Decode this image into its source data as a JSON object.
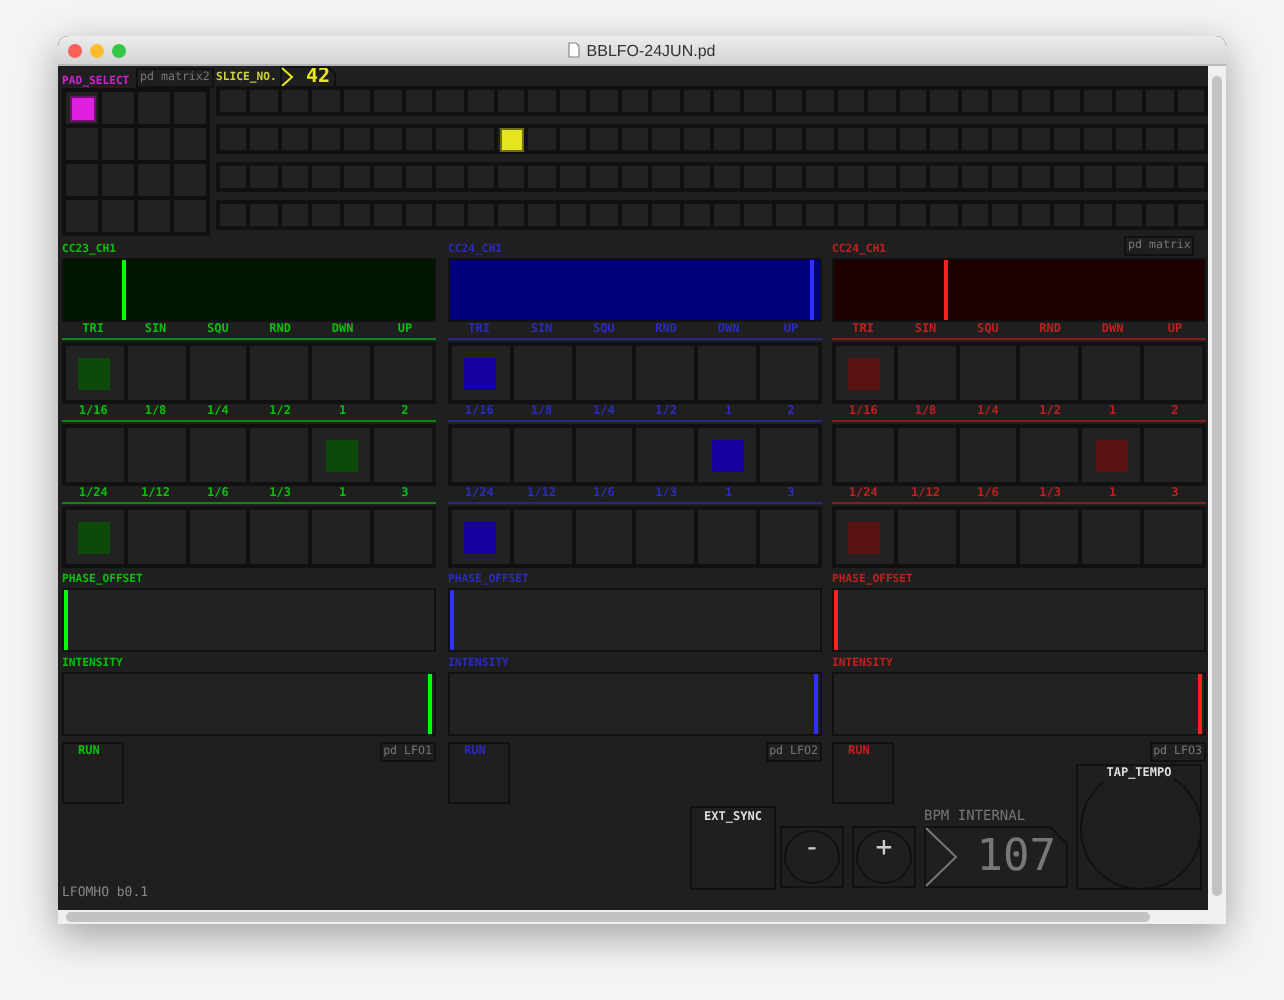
{
  "window": {
    "title": "BBLFO-24JUN.pd"
  },
  "pad_select": {
    "label": "PAD_SELECT",
    "pads": [
      {
        "selected": true
      },
      {
        "selected": false
      },
      {
        "selected": false
      },
      {
        "selected": false
      },
      {
        "selected": false
      },
      {
        "selected": false
      },
      {
        "selected": false
      },
      {
        "selected": false
      },
      {
        "selected": false
      },
      {
        "selected": false
      },
      {
        "selected": false
      },
      {
        "selected": false
      },
      {
        "selected": false
      },
      {
        "selected": false
      },
      {
        "selected": false
      },
      {
        "selected": false
      }
    ]
  },
  "matrix2_subpatch": "pd matrix2",
  "slice": {
    "label": "SLICE_NO.",
    "value": "42",
    "rows": [
      {
        "cells": [
          {
            "selected": false
          },
          {
            "selected": false
          },
          {
            "selected": false
          },
          {
            "selected": false
          },
          {
            "selected": false
          },
          {
            "selected": false
          },
          {
            "selected": false
          },
          {
            "selected": false
          },
          {
            "selected": false
          },
          {
            "selected": false
          },
          {
            "selected": false
          },
          {
            "selected": false
          },
          {
            "selected": false
          },
          {
            "selected": false
          },
          {
            "selected": false
          },
          {
            "selected": false
          },
          {
            "selected": false
          },
          {
            "selected": false
          },
          {
            "selected": false
          },
          {
            "selected": false
          },
          {
            "selected": false
          },
          {
            "selected": false
          },
          {
            "selected": false
          },
          {
            "selected": false
          },
          {
            "selected": false
          },
          {
            "selected": false
          },
          {
            "selected": false
          },
          {
            "selected": false
          },
          {
            "selected": false
          },
          {
            "selected": false
          },
          {
            "selected": false
          },
          {
            "selected": false
          }
        ]
      },
      {
        "cells": [
          {
            "selected": false
          },
          {
            "selected": false
          },
          {
            "selected": false
          },
          {
            "selected": false
          },
          {
            "selected": false
          },
          {
            "selected": false
          },
          {
            "selected": false
          },
          {
            "selected": false
          },
          {
            "selected": false
          },
          {
            "selected": true
          },
          {
            "selected": false
          },
          {
            "selected": false
          },
          {
            "selected": false
          },
          {
            "selected": false
          },
          {
            "selected": false
          },
          {
            "selected": false
          },
          {
            "selected": false
          },
          {
            "selected": false
          },
          {
            "selected": false
          },
          {
            "selected": false
          },
          {
            "selected": false
          },
          {
            "selected": false
          },
          {
            "selected": false
          },
          {
            "selected": false
          },
          {
            "selected": false
          },
          {
            "selected": false
          },
          {
            "selected": false
          },
          {
            "selected": false
          },
          {
            "selected": false
          },
          {
            "selected": false
          },
          {
            "selected": false
          },
          {
            "selected": false
          }
        ]
      },
      {
        "cells": [
          {
            "selected": false
          },
          {
            "selected": false
          },
          {
            "selected": false
          },
          {
            "selected": false
          },
          {
            "selected": false
          },
          {
            "selected": false
          },
          {
            "selected": false
          },
          {
            "selected": false
          },
          {
            "selected": false
          },
          {
            "selected": false
          },
          {
            "selected": false
          },
          {
            "selected": false
          },
          {
            "selected": false
          },
          {
            "selected": false
          },
          {
            "selected": false
          },
          {
            "selected": false
          },
          {
            "selected": false
          },
          {
            "selected": false
          },
          {
            "selected": false
          },
          {
            "selected": false
          },
          {
            "selected": false
          },
          {
            "selected": false
          },
          {
            "selected": false
          },
          {
            "selected": false
          },
          {
            "selected": false
          },
          {
            "selected": false
          },
          {
            "selected": false
          },
          {
            "selected": false
          },
          {
            "selected": false
          },
          {
            "selected": false
          },
          {
            "selected": false
          },
          {
            "selected": false
          }
        ]
      },
      {
        "cells": [
          {
            "selected": false
          },
          {
            "selected": false
          },
          {
            "selected": false
          },
          {
            "selected": false
          },
          {
            "selected": false
          },
          {
            "selected": false
          },
          {
            "selected": false
          },
          {
            "selected": false
          },
          {
            "selected": false
          },
          {
            "selected": false
          },
          {
            "selected": false
          },
          {
            "selected": false
          },
          {
            "selected": false
          },
          {
            "selected": false
          },
          {
            "selected": false
          },
          {
            "selected": false
          },
          {
            "selected": false
          },
          {
            "selected": false
          },
          {
            "selected": false
          },
          {
            "selected": false
          },
          {
            "selected": false
          },
          {
            "selected": false
          },
          {
            "selected": false
          },
          {
            "selected": false
          },
          {
            "selected": false
          },
          {
            "selected": false
          },
          {
            "selected": false
          },
          {
            "selected": false
          },
          {
            "selected": false
          },
          {
            "selected": false
          },
          {
            "selected": false
          },
          {
            "selected": false
          }
        ]
      }
    ]
  },
  "matrix_subpatch": "pd matrix",
  "lfos": [
    {
      "color": "#00ff00",
      "selection": {
        "color": "#0c4a0c"
      },
      "cc": {
        "label": "CC23_CH1",
        "level": 0.16,
        "color": "#001800"
      },
      "radios": [
        {
          "options": [
            {
              "label": "TRI",
              "selected": true
            },
            {
              "label": "SIN",
              "selected": false
            },
            {
              "label": "SQU",
              "selected": false
            },
            {
              "label": "RND",
              "selected": false
            },
            {
              "label": "DWN",
              "selected": false
            },
            {
              "label": "UP",
              "selected": false
            }
          ]
        },
        {
          "options": [
            {
              "label": "1/16",
              "selected": false
            },
            {
              "label": "1/8",
              "selected": false
            },
            {
              "label": "1/4",
              "selected": false
            },
            {
              "label": "1/2",
              "selected": false
            },
            {
              "label": "1",
              "selected": true
            },
            {
              "label": "2",
              "selected": false
            }
          ]
        },
        {
          "options": [
            {
              "label": "1/24",
              "selected": true
            },
            {
              "label": "1/12",
              "selected": false
            },
            {
              "label": "1/6",
              "selected": false
            },
            {
              "label": "1/3",
              "selected": false
            },
            {
              "label": "1",
              "selected": false
            },
            {
              "label": "3",
              "selected": false
            }
          ]
        }
      ],
      "phase": {
        "label": "PHASE_OFFSET",
        "level": 0
      },
      "intensity": {
        "label": "INTENSITY",
        "level": 1
      },
      "run": {
        "label": "RUN",
        "on": false
      },
      "subpatch": "pd LFO1"
    },
    {
      "color": "#3030ff",
      "selection": {
        "color": "#1400a0"
      },
      "cc": {
        "label": "CC24_CH1",
        "level": 0.99,
        "color": "#00007c"
      },
      "radios": [
        {
          "options": [
            {
              "label": "TRI",
              "selected": true
            },
            {
              "label": "SIN",
              "selected": false
            },
            {
              "label": "SQU",
              "selected": false
            },
            {
              "label": "RND",
              "selected": false
            },
            {
              "label": "DWN",
              "selected": false
            },
            {
              "label": "UP",
              "selected": false
            }
          ]
        },
        {
          "options": [
            {
              "label": "1/16",
              "selected": false
            },
            {
              "label": "1/8",
              "selected": false
            },
            {
              "label": "1/4",
              "selected": false
            },
            {
              "label": "1/2",
              "selected": false
            },
            {
              "label": "1",
              "selected": true
            },
            {
              "label": "2",
              "selected": false
            }
          ]
        },
        {
          "options": [
            {
              "label": "1/24",
              "selected": true
            },
            {
              "label": "1/12",
              "selected": false
            },
            {
              "label": "1/6",
              "selected": false
            },
            {
              "label": "1/3",
              "selected": false
            },
            {
              "label": "1",
              "selected": false
            },
            {
              "label": "3",
              "selected": false
            }
          ]
        }
      ],
      "phase": {
        "label": "PHASE_OFFSET",
        "level": 0
      },
      "intensity": {
        "label": "INTENSITY",
        "level": 1
      },
      "run": {
        "label": "RUN",
        "on": false
      },
      "subpatch": "pd LFO2"
    },
    {
      "color": "#ff2020",
      "selection": {
        "color": "#5a1414"
      },
      "cc": {
        "label": "CC24_CH1",
        "level": 0.3,
        "color": "#1e0000"
      },
      "radios": [
        {
          "options": [
            {
              "label": "TRI",
              "selected": true
            },
            {
              "label": "SIN",
              "selected": false
            },
            {
              "label": "SQU",
              "selected": false
            },
            {
              "label": "RND",
              "selected": false
            },
            {
              "label": "DWN",
              "selected": false
            },
            {
              "label": "UP",
              "selected": false
            }
          ]
        },
        {
          "options": [
            {
              "label": "1/16",
              "selected": false
            },
            {
              "label": "1/8",
              "selected": false
            },
            {
              "label": "1/4",
              "selected": false
            },
            {
              "label": "1/2",
              "selected": false
            },
            {
              "label": "1",
              "selected": true
            },
            {
              "label": "2",
              "selected": false
            }
          ]
        },
        {
          "options": [
            {
              "label": "1/24",
              "selected": true
            },
            {
              "label": "1/12",
              "selected": false
            },
            {
              "label": "1/6",
              "selected": false
            },
            {
              "label": "1/3",
              "selected": false
            },
            {
              "label": "1",
              "selected": false
            },
            {
              "label": "3",
              "selected": false
            }
          ]
        }
      ],
      "phase": {
        "label": "PHASE_OFFSET",
        "level": 0
      },
      "intensity": {
        "label": "INTENSITY",
        "level": 1
      },
      "run": {
        "label": "RUN",
        "on": false
      },
      "subpatch": "pd LFO3"
    }
  ],
  "tempo": {
    "ext_sync": "EXT_SYNC",
    "minus": "-",
    "plus": "+",
    "bpm_label": "BPM INTERNAL",
    "bpm": "107",
    "tap": "TAP_TEMPO"
  },
  "footer": "LFOMHO b0.1"
}
